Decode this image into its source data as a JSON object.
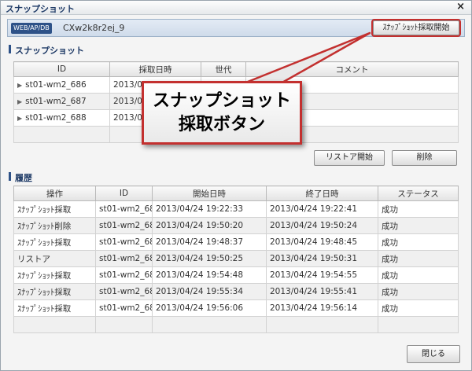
{
  "window": {
    "title": "スナップショット",
    "close_icon": "×"
  },
  "infobar": {
    "badge": "WEB/AP/DB",
    "hostname": "CXw2k8r2ej_9",
    "snapshot_button": "ｽﾅｯﾌﾟｼｮｯﾄ採取開始"
  },
  "snapshot_section": {
    "title": "スナップショット",
    "columns": [
      "ID",
      "採取日時",
      "世代",
      "コメント"
    ],
    "rows": [
      {
        "id": "st01-wm2_686",
        "date": "2013/04",
        "gen": "",
        "comment": ""
      },
      {
        "id": "st01-wm2_687",
        "date": "2013/04",
        "gen": "",
        "comment": ""
      },
      {
        "id": "st01-wm2_688",
        "date": "2013/04",
        "gen": "",
        "comment": ""
      }
    ],
    "restore_button": "リストア開始",
    "delete_button": "削除"
  },
  "history_section": {
    "title": "履歴",
    "columns": [
      "操作",
      "ID",
      "開始日時",
      "終了日時",
      "ステータス"
    ],
    "rows": [
      {
        "op": "ｽﾅｯﾌﾟｼｮｯﾄ採取",
        "id": "st01-wm2_68",
        "start": "2013/04/24 19:22:33",
        "end": "2013/04/24 19:22:41",
        "status": "成功"
      },
      {
        "op": "ｽﾅｯﾌﾟｼｮｯﾄ削除",
        "id": "st01-wm2_68",
        "start": "2013/04/24 19:50:20",
        "end": "2013/04/24 19:50:24",
        "status": "成功"
      },
      {
        "op": "ｽﾅｯﾌﾟｼｮｯﾄ採取",
        "id": "st01-wm2_68",
        "start": "2013/04/24 19:48:37",
        "end": "2013/04/24 19:48:45",
        "status": "成功"
      },
      {
        "op": "リストア",
        "id": "st01-wm2_68",
        "start": "2013/04/24 19:50:25",
        "end": "2013/04/24 19:50:31",
        "status": "成功"
      },
      {
        "op": "ｽﾅｯﾌﾟｼｮｯﾄ採取",
        "id": "st01-wm2_68",
        "start": "2013/04/24 19:54:48",
        "end": "2013/04/24 19:54:55",
        "status": "成功"
      },
      {
        "op": "ｽﾅｯﾌﾟｼｮｯﾄ採取",
        "id": "st01-wm2_68",
        "start": "2013/04/24 19:55:34",
        "end": "2013/04/24 19:55:41",
        "status": "成功"
      },
      {
        "op": "ｽﾅｯﾌﾟｼｮｯﾄ採取",
        "id": "st01-wm2_68",
        "start": "2013/04/24 19:56:06",
        "end": "2013/04/24 19:56:14",
        "status": "成功"
      }
    ]
  },
  "footer": {
    "close_button": "閉じる"
  },
  "callout": {
    "line1": "スナップショット",
    "line2": "採取ボタン"
  }
}
